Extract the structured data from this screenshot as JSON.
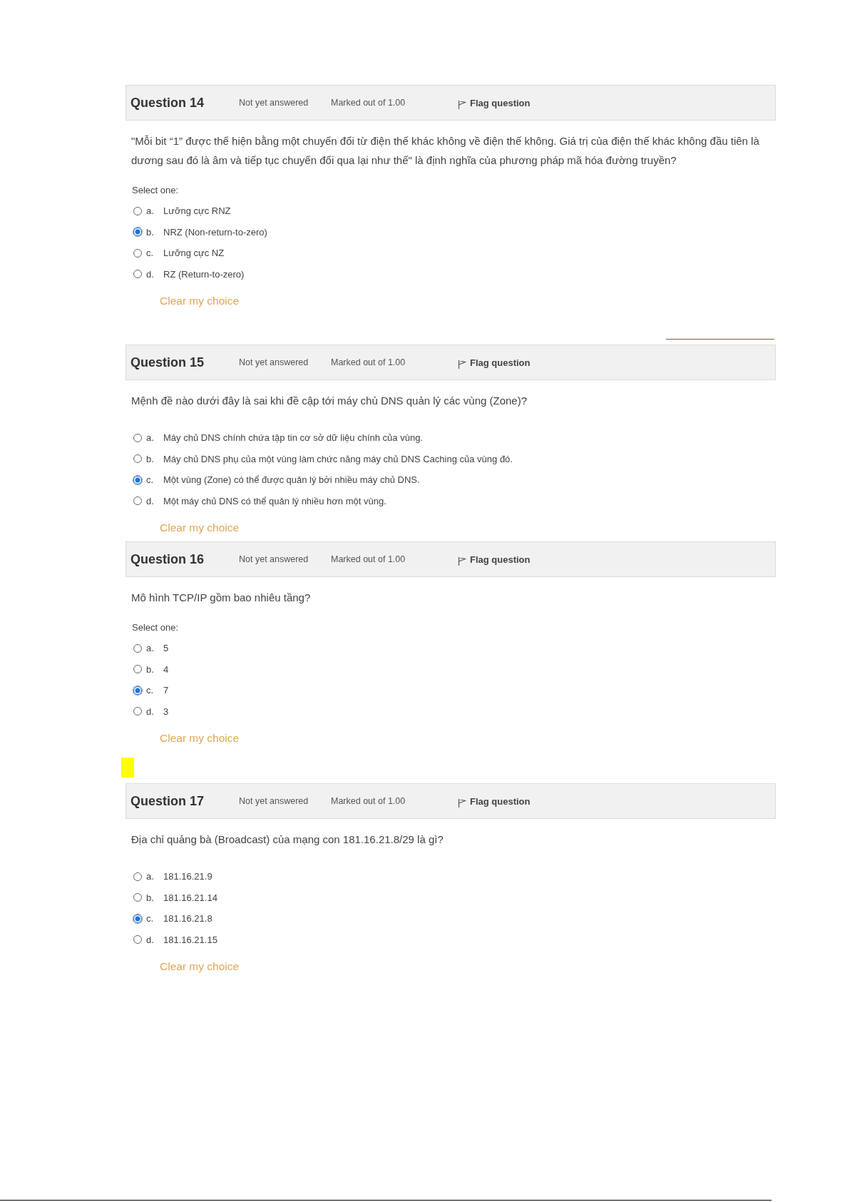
{
  "questions": [
    {
      "number": "Question 14",
      "status": "Not yet answered",
      "marks": "Marked out of 1.00",
      "flag": "Flag question",
      "text": "\"Mỗi bit “1” được thể hiện bằng một chuyển đổi từ điện thế khác không về điện thế không. Giá trị của điện thế khác không đầu tiên là dương sau đó là âm và tiếp tục chuyển đổi qua lại như thế\" là định nghĩa của phương pháp mã hóa đường truyền?",
      "prompt": "Select one:",
      "options": [
        {
          "letter": "a.",
          "label": "Lưỡng cực RNZ",
          "selected": false
        },
        {
          "letter": "b.",
          "label": "NRZ (Non-return-to-zero)",
          "selected": true
        },
        {
          "letter": "c.",
          "label": "Lưỡng cực NZ",
          "selected": false
        },
        {
          "letter": "d.",
          "label": "RZ (Return-to-zero)",
          "selected": false
        }
      ],
      "clear": "Clear my choice"
    },
    {
      "number": "Question 15",
      "status": "Not yet answered",
      "marks": "Marked out of 1.00",
      "flag": "Flag question",
      "text": "Mệnh đề nào dưới đây là sai khi đề cập tới máy chủ DNS quản lý các vùng (Zone)?",
      "options": [
        {
          "letter": "a.",
          "label": "Máy chủ DNS chính chứa tập tin cơ sở dữ liệu chính của vùng.",
          "selected": false
        },
        {
          "letter": "b.",
          "label": "Máy chủ DNS phụ của một vùng làm chức năng máy chủ DNS Caching của vùng đó.",
          "selected": false
        },
        {
          "letter": "c.",
          "label": "Một vùng (Zone) có thể được quản lý bởi nhiều máy chủ DNS.",
          "selected": true
        },
        {
          "letter": "d.",
          "label": "Một máy chủ DNS có thể quản lý nhiều hơn một vùng.",
          "selected": false
        }
      ],
      "clear": "Clear my choice"
    },
    {
      "number": "Question 16",
      "status": "Not yet answered",
      "marks": "Marked out of 1.00",
      "flag": "Flag question",
      "text": "Mô hình TCP/IP gồm bao nhiêu tầng?",
      "prompt": "Select one:",
      "options": [
        {
          "letter": "a.",
          "label": "5",
          "selected": false
        },
        {
          "letter": "b.",
          "label": "4",
          "selected": false
        },
        {
          "letter": "c.",
          "label": "7",
          "selected": true
        },
        {
          "letter": "d.",
          "label": "3",
          "selected": false
        }
      ],
      "clear": "Clear my choice"
    },
    {
      "number": "Question 17",
      "status": "Not yet answered",
      "marks": "Marked out of 1.00",
      "flag": "Flag question",
      "text": "Địa chỉ quảng bà (Broadcast) của mạng con 181.16.21.8/29 là gì?",
      "options": [
        {
          "letter": "a.",
          "label": "181.16.21.9",
          "selected": false
        },
        {
          "letter": "b.",
          "label": "181.16.21.14",
          "selected": false
        },
        {
          "letter": "c.",
          "label": "181.16.21.8",
          "selected": true
        },
        {
          "letter": "d.",
          "label": "181.16.21.15",
          "selected": false
        }
      ],
      "clear": "Clear my choice"
    }
  ]
}
